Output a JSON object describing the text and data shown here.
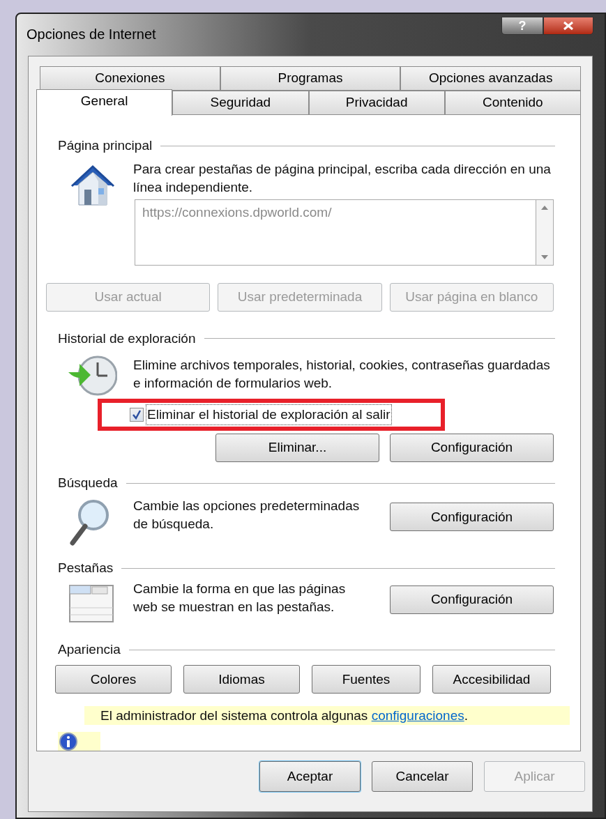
{
  "window": {
    "title": "Opciones de Internet",
    "help_label": "?"
  },
  "tab_rows": [
    {
      "tabs": [
        {
          "label": "Conexiones",
          "selected": false
        },
        {
          "label": "Programas",
          "selected": false
        },
        {
          "label": "Opciones avanzadas",
          "selected": false
        }
      ]
    },
    {
      "tabs": [
        {
          "label": "General",
          "selected": true
        },
        {
          "label": "Seguridad",
          "selected": false
        },
        {
          "label": "Privacidad",
          "selected": false
        },
        {
          "label": "Contenido",
          "selected": false
        }
      ]
    }
  ],
  "home_page": {
    "heading": "Página principal",
    "description": "Para crear pestañas de página principal, escriba cada dirección en una línea independiente.",
    "addresses": "https://connexions.dpworld.com/",
    "buttons": [
      {
        "label": "Usar actual",
        "disabled": true
      },
      {
        "label": "Usar predeterminada",
        "disabled": true
      },
      {
        "label": "Usar página en blanco",
        "disabled": true
      }
    ]
  },
  "history": {
    "heading": "Historial de exploración",
    "description": "Elimine archivos temporales, historial, cookies, contraseñas guardadas e información de formularios web.",
    "delete_on_exit": {
      "label": "Eliminar el historial de exploración al salir",
      "checked": true,
      "highlighted": true
    },
    "buttons": [
      {
        "label": "Eliminar...",
        "disabled": false
      },
      {
        "label": "Configuración",
        "disabled": false
      }
    ]
  },
  "search": {
    "heading": "Búsqueda",
    "description": "Cambie las opciones predeterminadas de búsqueda.",
    "button": {
      "label": "Configuración",
      "disabled": false
    }
  },
  "tabs_section": {
    "heading": "Pestañas",
    "description": "Cambie la forma en que las páginas web se muestran en las pestañas.",
    "button": {
      "label": "Configuración",
      "disabled": false
    }
  },
  "appearance": {
    "heading": "Apariencia",
    "buttons": [
      {
        "label": "Colores",
        "disabled": false
      },
      {
        "label": "Idiomas",
        "disabled": false
      },
      {
        "label": "Fuentes",
        "disabled": false
      },
      {
        "label": "Accesibilidad",
        "disabled": false
      }
    ]
  },
  "notice": {
    "text": "El administrador del sistema controla algunas",
    "link": "configuraciones",
    "end": "."
  },
  "dialog_buttons": [
    {
      "label": "Aceptar",
      "default": true,
      "disabled": false
    },
    {
      "label": "Cancelar",
      "default": false,
      "disabled": false
    },
    {
      "label": "Aplicar",
      "default": false,
      "disabled": true
    }
  ]
}
